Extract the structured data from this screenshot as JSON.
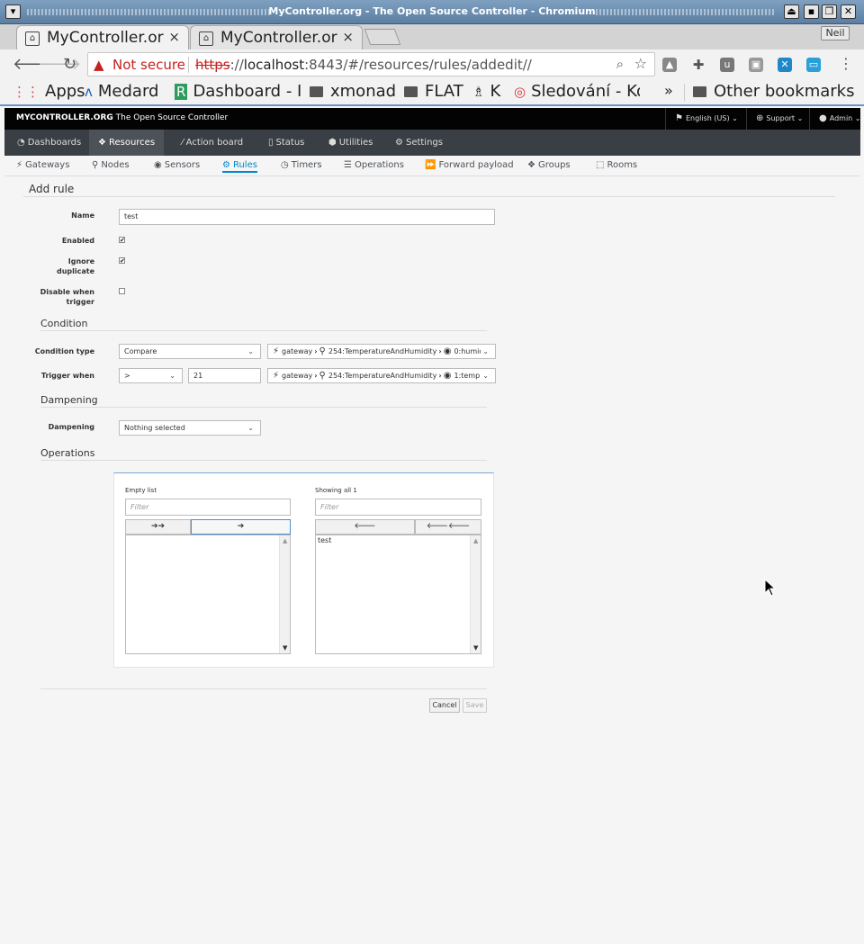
{
  "window": {
    "title": "MyController.org - The Open Source Controller - Chromium"
  },
  "browser": {
    "tabs": [
      {
        "label": "MyController.or",
        "close": "×"
      },
      {
        "label": "MyController.or",
        "close": "×"
      }
    ],
    "user": "Neil",
    "security": "Not secure",
    "url": {
      "scheme": "https",
      "sep": "://",
      "host": "localhost",
      "rest": ":8443/#/resources/rules/addedit//"
    },
    "bookmarks": [
      "Apps",
      "Medard",
      "Dashboard - I",
      "xmonad",
      "FLAT",
      "K",
      "Sledování - Ko"
    ],
    "more": "»",
    "other_bookmarks": "Other bookmarks"
  },
  "app": {
    "brand_bold": "MYCONTROLLER.ORG",
    "brand_rest": "The Open Source Controller",
    "language": "English (US)",
    "support": "Support",
    "user": "Admin",
    "main_nav": [
      "Dashboards",
      "Resources",
      "Action board",
      "Status",
      "Utilities",
      "Settings"
    ],
    "active_main": "Resources",
    "sub_nav": [
      "Gateways",
      "Nodes",
      "Sensors",
      "Rules",
      "Timers",
      "Operations",
      "Forward payload",
      "Groups",
      "Rooms"
    ],
    "active_sub": "Rules"
  },
  "form": {
    "title": "Add rule",
    "name_label": "Name",
    "name_value": "test",
    "enabled_label": "Enabled",
    "enabled": true,
    "ignore_label_1": "Ignore",
    "ignore_label_2": "duplicate",
    "ignore_duplicate": true,
    "disable_label_1": "Disable when",
    "disable_label_2": "trigger",
    "disable_when_trigger": false,
    "condition_section": "Condition",
    "condition_type_label": "Condition type",
    "condition_type": "Compare",
    "condition_path": {
      "gateway": "gateway",
      "node": "254:TemperatureAndHumidity",
      "sensor": "0:humidi"
    },
    "trigger_when_label": "Trigger when",
    "trigger_operator": ">",
    "trigger_value": "21",
    "trigger_path": {
      "gateway": "gateway",
      "node": "254:TemperatureAndHumidity",
      "sensor": "1:temp"
    },
    "dampening_section": "Dampening",
    "dampening_label": "Dampening",
    "dampening_value": "Nothing selected",
    "operations_section": "Operations",
    "left_list_title": "Empty list",
    "right_list_title": "Showing all 1",
    "filter_placeholder": "Filter",
    "move_all_right": "➔➔",
    "move_right": "➔",
    "move_left": "🡐",
    "move_all_left": "🡐🡐",
    "selected_operations": [
      "test"
    ],
    "cancel": "Cancel",
    "save": "Save"
  }
}
